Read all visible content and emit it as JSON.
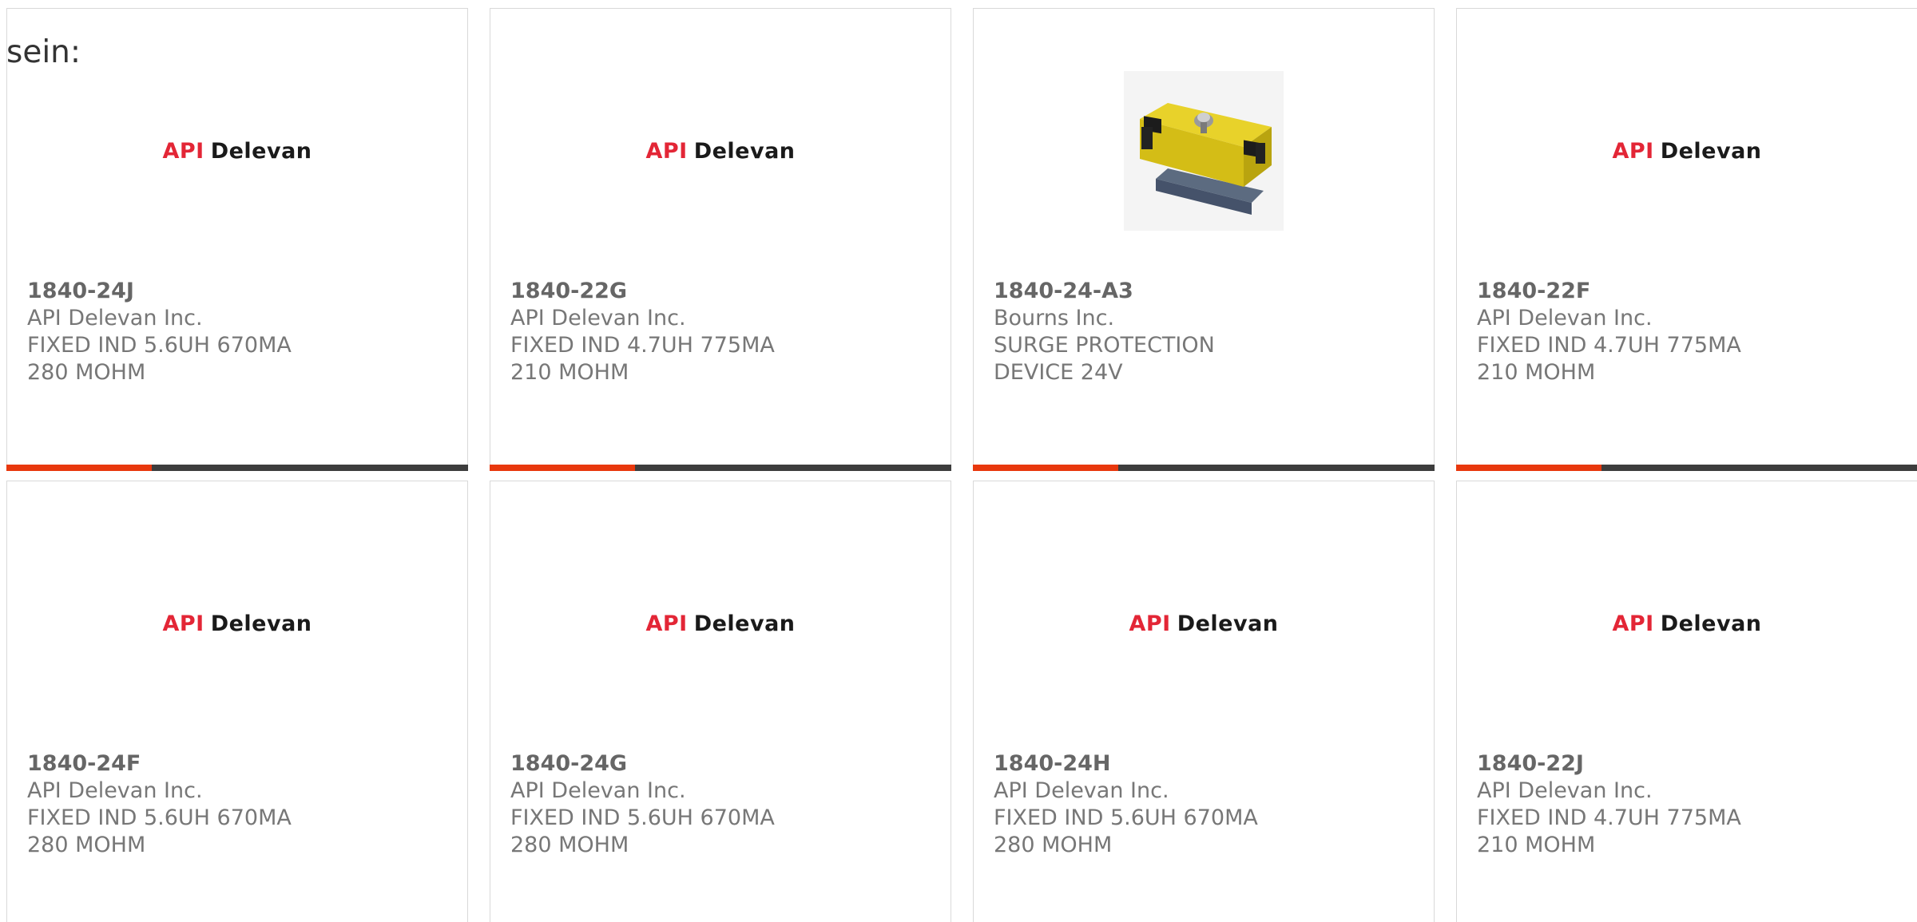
{
  "intro_text": "sein:",
  "colors": {
    "accent": "#e8380d",
    "bar": "#3d3d3d",
    "brand_red": "#e32636"
  },
  "cards": [
    {
      "part_number": "1840-24J",
      "manufacturer": "API Delevan Inc.",
      "description": "FIXED IND 5.6UH 670MA 280 MOHM",
      "image": {
        "type": "logo",
        "brand_a": "API",
        "brand_b": "Delevan"
      },
      "show_bar": true
    },
    {
      "part_number": "1840-22G",
      "manufacturer": "API Delevan Inc.",
      "description": "FIXED IND 4.7UH 775MA 210 MOHM",
      "image": {
        "type": "logo",
        "brand_a": "API",
        "brand_b": "Delevan"
      },
      "show_bar": true
    },
    {
      "part_number": "1840-24-A3",
      "manufacturer": "Bourns Inc.",
      "description": "SURGE PROTECTION DEVICE 24V",
      "image": {
        "type": "photo",
        "icon": "surge-protector-photo"
      },
      "show_bar": true
    },
    {
      "part_number": "1840-22F",
      "manufacturer": "API Delevan Inc.",
      "description": "FIXED IND 4.7UH 775MA 210 MOHM",
      "image": {
        "type": "logo",
        "brand_a": "API",
        "brand_b": "Delevan"
      },
      "show_bar": true
    },
    {
      "part_number": "1840-24F",
      "manufacturer": "API Delevan Inc.",
      "description": "FIXED IND 5.6UH 670MA 280 MOHM",
      "image": {
        "type": "logo",
        "brand_a": "API",
        "brand_b": "Delevan"
      },
      "show_bar": false
    },
    {
      "part_number": "1840-24G",
      "manufacturer": "API Delevan Inc.",
      "description": "FIXED IND 5.6UH 670MA 280 MOHM",
      "image": {
        "type": "logo",
        "brand_a": "API",
        "brand_b": "Delevan"
      },
      "show_bar": false
    },
    {
      "part_number": "1840-24H",
      "manufacturer": "API Delevan Inc.",
      "description": "FIXED IND 5.6UH 670MA 280 MOHM",
      "image": {
        "type": "logo",
        "brand_a": "API",
        "brand_b": "Delevan"
      },
      "show_bar": false
    },
    {
      "part_number": "1840-22J",
      "manufacturer": "API Delevan Inc.",
      "description": "FIXED IND 4.7UH 775MA 210 MOHM",
      "image": {
        "type": "logo",
        "brand_a": "API",
        "brand_b": "Delevan"
      },
      "show_bar": false
    }
  ]
}
